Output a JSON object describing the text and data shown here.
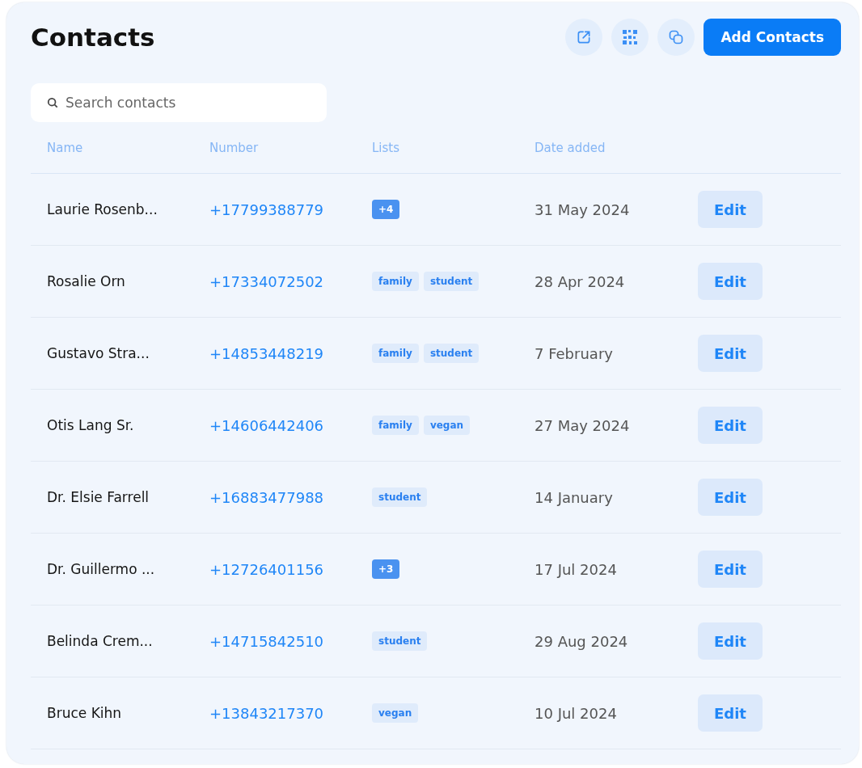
{
  "title": "Contacts",
  "toolbar": {
    "add_button": "Add Contacts"
  },
  "search": {
    "placeholder": "Search contacts"
  },
  "table": {
    "columns": [
      "Name",
      "Number",
      "Lists",
      "Date added"
    ],
    "rows": [
      {
        "name": "Laurie Rosenb...",
        "number": "+17799388779",
        "lists": [
          {
            "kind": "count",
            "label": "+4"
          }
        ],
        "date": "31 May 2024",
        "action": "Edit"
      },
      {
        "name": "Rosalie Orn",
        "number": "+17334072502",
        "lists": [
          {
            "kind": "tag",
            "label": "family"
          },
          {
            "kind": "tag",
            "label": "student"
          }
        ],
        "date": "28 Apr 2024",
        "action": "Edit"
      },
      {
        "name": "Gustavo Stra...",
        "number": "+14853448219",
        "lists": [
          {
            "kind": "tag",
            "label": "family"
          },
          {
            "kind": "tag",
            "label": "student"
          }
        ],
        "date": "7 February",
        "action": "Edit"
      },
      {
        "name": "Otis Lang Sr.",
        "number": "+14606442406",
        "lists": [
          {
            "kind": "tag",
            "label": "family"
          },
          {
            "kind": "tag",
            "label": "vegan"
          }
        ],
        "date": "27 May 2024",
        "action": "Edit"
      },
      {
        "name": "Dr. Elsie Farrell",
        "number": "+16883477988",
        "lists": [
          {
            "kind": "tag",
            "label": "student"
          }
        ],
        "date": "14 January",
        "action": "Edit"
      },
      {
        "name": "Dr. Guillermo ...",
        "number": "+12726401156",
        "lists": [
          {
            "kind": "count",
            "label": "+3"
          }
        ],
        "date": "17 Jul 2024",
        "action": "Edit"
      },
      {
        "name": "Belinda Crem...",
        "number": "+14715842510",
        "lists": [
          {
            "kind": "tag",
            "label": "student"
          }
        ],
        "date": "29 Aug 2024",
        "action": "Edit"
      },
      {
        "name": "Bruce Kihn",
        "number": "+13843217370",
        "lists": [
          {
            "kind": "tag",
            "label": "vegan"
          }
        ],
        "date": "10 Jul 2024",
        "action": "Edit"
      }
    ]
  }
}
